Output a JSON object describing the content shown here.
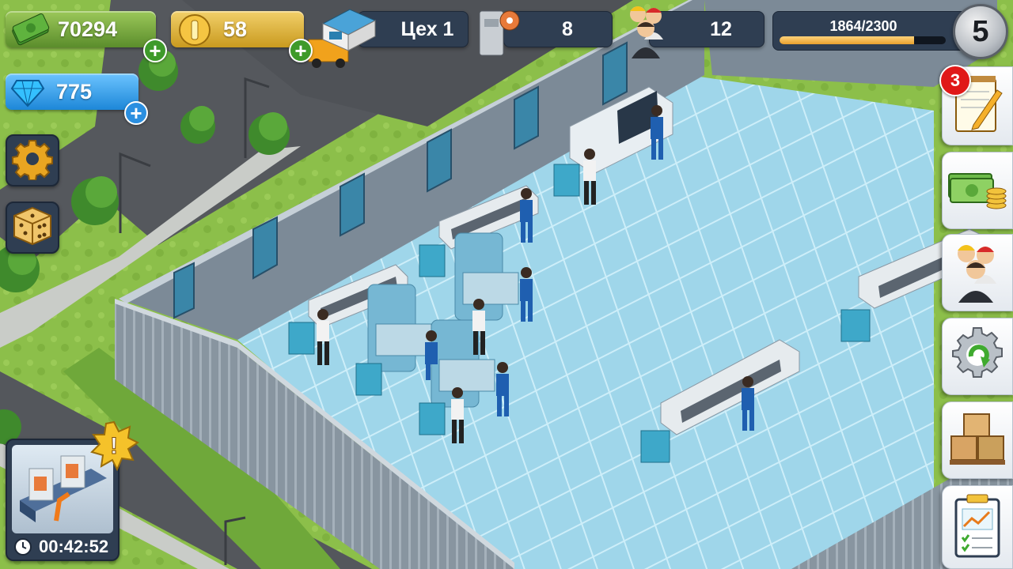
{
  "hud": {
    "money": "70294",
    "coins": "58",
    "gems": "775",
    "workshop_name": "Цех 1",
    "machines_count": "8",
    "workers_count": "12",
    "xp_text": "1864/2300",
    "xp_fraction": 0.81,
    "level": "5"
  },
  "tasks_badge": "3",
  "production": {
    "timer": "00:42:52",
    "alert_symbol": "!"
  },
  "icons": {
    "money": "cash-stack-icon",
    "coins": "gold-coin-icon",
    "gems": "diamond-icon",
    "workshop": "warehouse-icon",
    "machines": "press-machine-icon",
    "workers": "workers-icon",
    "settings": "gear-icon",
    "random": "dice-icon",
    "tasks": "notepad-pencil-icon",
    "finance": "cash-coins-icon",
    "staff": "staff-group-icon",
    "upgrade": "gear-refresh-icon",
    "storage": "boxes-icon",
    "stats": "report-chart-icon",
    "timer": "clock-icon"
  }
}
